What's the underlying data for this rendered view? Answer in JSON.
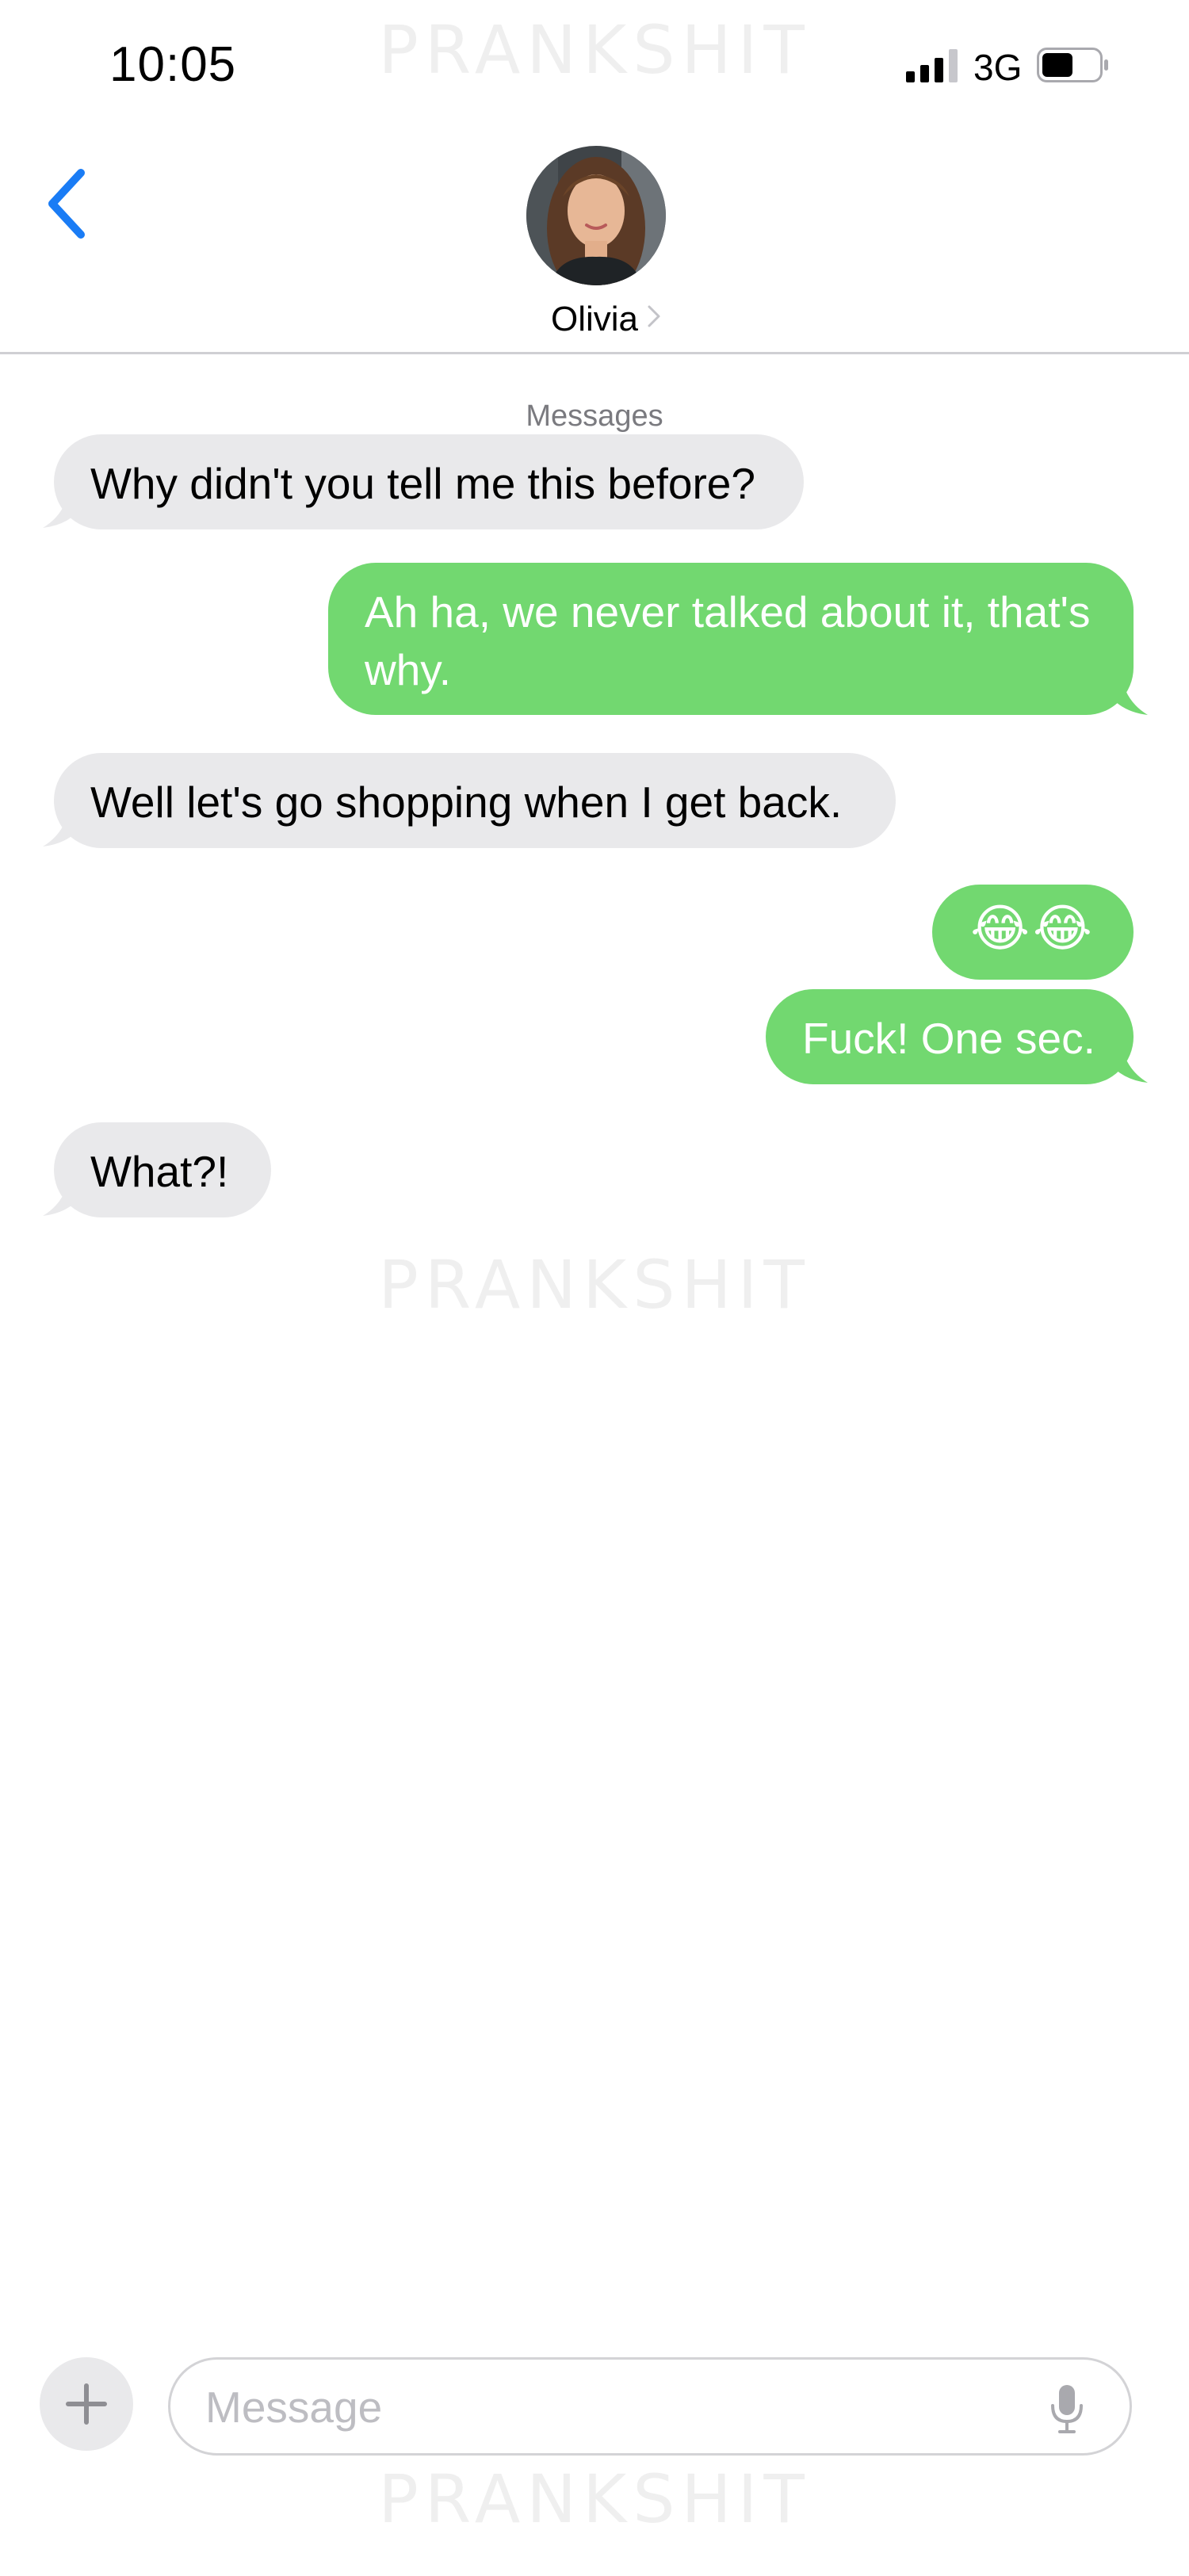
{
  "status_bar": {
    "time": "10:05",
    "network": "3G"
  },
  "watermark": "PRANKSHIT",
  "header": {
    "contact_name": "Olivia",
    "service_label": "Messages",
    "back_icon": "chevron-left-icon",
    "contact_chevron_icon": "chevron-right-icon"
  },
  "messages": [
    {
      "direction": "incoming",
      "text": "Why didn't you tell me this before?"
    },
    {
      "direction": "outgoing",
      "text": "Ah ha, we never talked about it, that's why."
    },
    {
      "direction": "incoming",
      "text": "Well let's go shopping when I get back."
    },
    {
      "direction": "outgoing",
      "text": "😂😂"
    },
    {
      "direction": "outgoing",
      "text": "Fuck! One sec."
    },
    {
      "direction": "incoming",
      "text": "What?!"
    }
  ],
  "composer": {
    "placeholder": "Message",
    "add_icon": "plus-icon",
    "mic_icon": "microphone-icon"
  },
  "colors": {
    "accent_blue": "#1a7cf5",
    "outgoing_bubble": "#72d870",
    "incoming_bubble": "#e9e9eb",
    "background": "#ffffff"
  }
}
